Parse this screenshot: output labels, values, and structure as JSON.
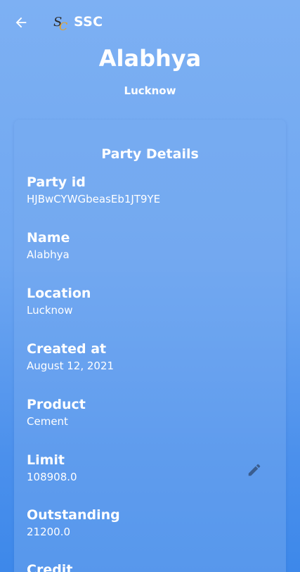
{
  "app": {
    "title": "SSC"
  },
  "header": {
    "name": "Alabhya",
    "location": "Lucknow"
  },
  "card": {
    "title": "Party Details",
    "fields": [
      {
        "label": "Party id",
        "value": "HJBwCYWGbeasEb1JT9YE"
      },
      {
        "label": "Name",
        "value": "Alabhya"
      },
      {
        "label": "Location",
        "value": "Lucknow"
      },
      {
        "label": "Created at",
        "value": "August 12, 2021"
      },
      {
        "label": "Product",
        "value": "Cement"
      },
      {
        "label": "Limit",
        "value": "108908.0"
      },
      {
        "label": "Outstanding",
        "value": "21200.0"
      },
      {
        "label": "Credit",
        "value": ""
      }
    ]
  },
  "icons": {
    "back": "arrow-back-icon",
    "edit": "pencil-edit-icon",
    "logo": "ssc-logo"
  },
  "colors": {
    "background_top": "#7db0f3",
    "background_bottom": "#3d88ea",
    "edit_icon": "#3a5d8f"
  }
}
